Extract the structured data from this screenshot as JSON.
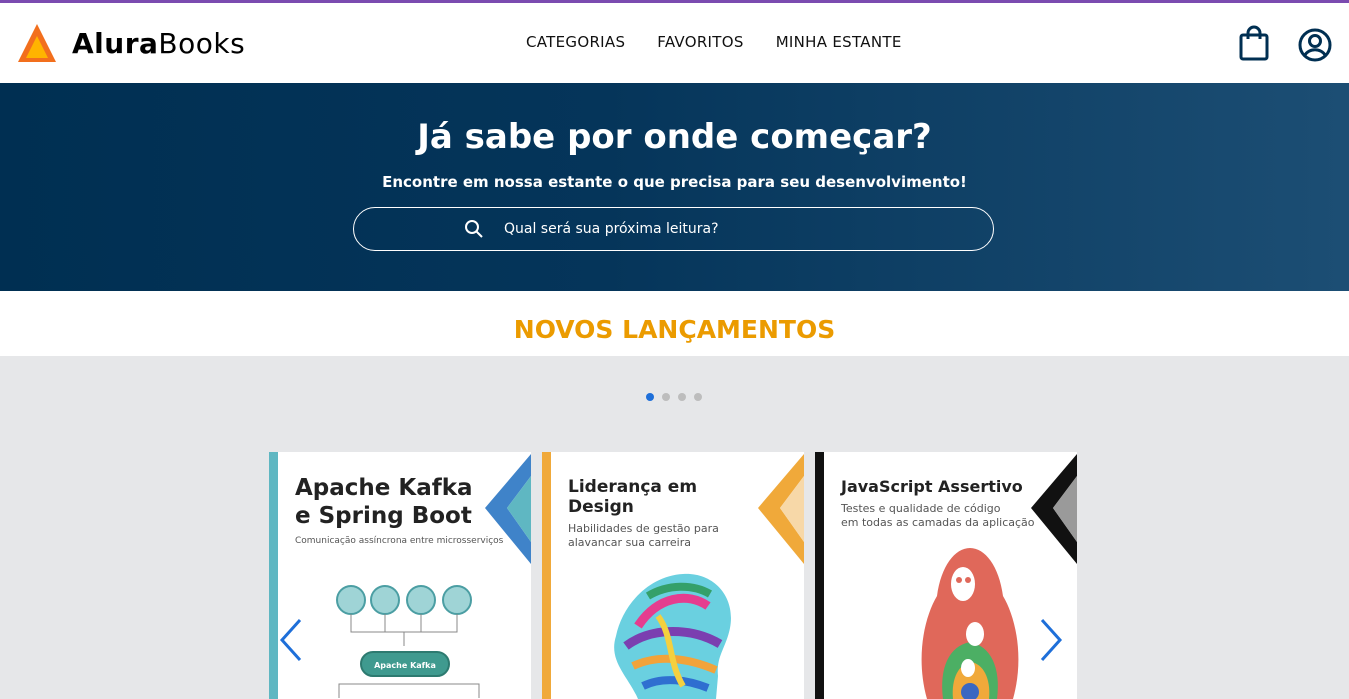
{
  "brand": {
    "name_bold": "Alura",
    "name_rest": "Books"
  },
  "nav": {
    "items": [
      "CATEGORIAS",
      "FAVORITOS",
      "MINHA ESTANTE"
    ]
  },
  "hero": {
    "title": "Já sabe por onde começar?",
    "subtitle": "Encontre em nossa estante o que precisa para seu desenvolvimento!",
    "search_placeholder": "Qual será sua próxima leitura?"
  },
  "releases": {
    "title": "NOVOS LANÇAMENTOS",
    "dots": {
      "count": 4,
      "active": 1
    },
    "books": [
      {
        "title_l1": "Apache Kafka",
        "title_l2": "e Spring Boot",
        "subtitle": "Comunicação assíncrona entre microsserviços",
        "inner": "Apache Kafka",
        "accent": "#5fb7c2",
        "accent2": "#3f83c9"
      },
      {
        "title_l1": "Liderança em",
        "title_l2": "Design",
        "subtitle_l1": "Habilidades de gestão para",
        "subtitle_l2": "alavancar sua carreira",
        "accent": "#f0a93a",
        "accent2": "#f7cf8e"
      },
      {
        "title_l1": "JavaScript Assertivo",
        "subtitle_l1": "Testes e qualidade de código",
        "subtitle_l2": "em todas as camadas da aplicação",
        "accent": "#111111",
        "accent2": "#9a9a9a"
      }
    ]
  },
  "icons": [
    "logo-icon",
    "shopping-bag-icon",
    "user-account-icon",
    "search-icon",
    "chevron-left-icon",
    "chevron-right-icon"
  ],
  "colors": {
    "brand_orange": "#f26f1d",
    "hero_blue": "#002f52",
    "releases_title": "#eb9b00",
    "arrow_blue": "#1e6fd9"
  }
}
